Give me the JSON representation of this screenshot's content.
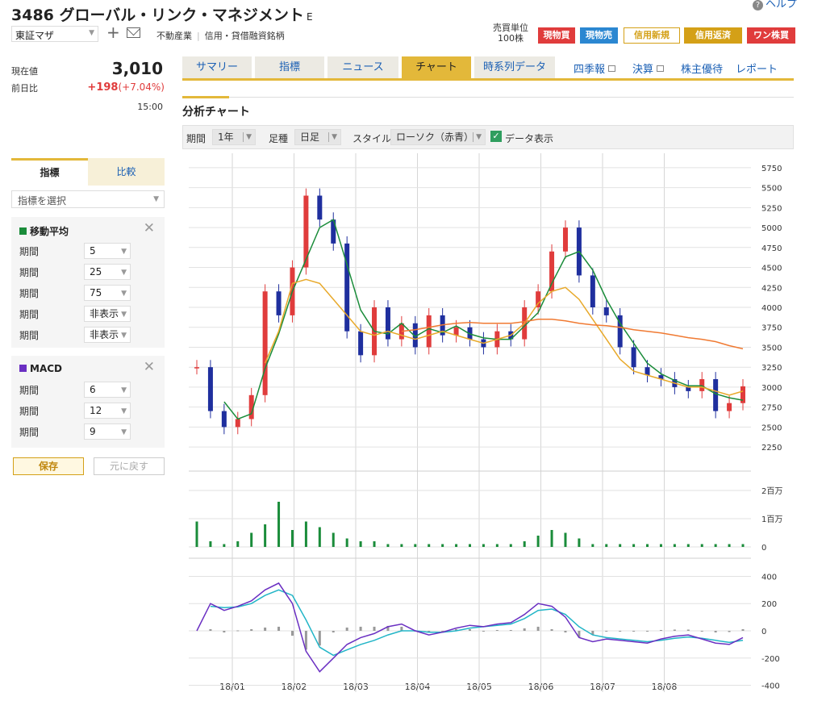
{
  "header": {
    "title": "3486 グローバル・リンク・マネジメント",
    "title_suffix": "E",
    "help": "ヘルプ",
    "market": "東証マザ",
    "sector": "不動産業",
    "margin": "信用・貸借融資銘柄",
    "unit_label_1": "売買単位",
    "unit_label_2": "100株",
    "badges": [
      "現物買",
      "現物売",
      "信用新規",
      "信用返済",
      "ワン株買"
    ]
  },
  "quote": {
    "price_label": "現在値",
    "price": "3,010",
    "change_label": "前日比",
    "change": "+198",
    "change_pct": "(+7.04%)",
    "time": "15:00"
  },
  "tabs": [
    "サマリー",
    "指標",
    "ニュース",
    "チャート",
    "時系列データ"
  ],
  "links": [
    "四季報",
    "決算",
    "株主優待",
    "レポート"
  ],
  "section_title": "分析チャート",
  "toolbar": {
    "period_label": "期間",
    "period_value": "1年",
    "bar_label": "足種",
    "bar_value": "日足",
    "style_label": "スタイル",
    "style_value": "ローソク（赤青）",
    "data_display": "データ表示"
  },
  "side": {
    "tab_indicator": "指標",
    "tab_compare": "比較",
    "select_placeholder": "指標を選択",
    "ma": {
      "title": "移動平均",
      "color": "#1a8c3a",
      "rows": [
        {
          "label": "期間",
          "value": "5"
        },
        {
          "label": "期間",
          "value": "25"
        },
        {
          "label": "期間",
          "value": "75"
        },
        {
          "label": "期間",
          "value": "非表示"
        },
        {
          "label": "期間",
          "value": "非表示"
        }
      ]
    },
    "macd": {
      "title": "MACD",
      "color": "#6a2fc2",
      "rows": [
        {
          "label": "期間",
          "value": "6"
        },
        {
          "label": "期間",
          "value": "12"
        },
        {
          "label": "期間",
          "value": "9"
        }
      ]
    },
    "save": "保存",
    "reset": "元に戻す"
  },
  "chart_data": {
    "type": "line",
    "x_ticks": [
      "18/01",
      "18/02",
      "18/03",
      "18/04",
      "18/05",
      "18/06",
      "18/07",
      "18/08"
    ],
    "price_axis": [
      5750,
      5500,
      5250,
      5000,
      4750,
      4500,
      4250,
      4000,
      3750,
      3500,
      3250,
      3000,
      2750,
      2500,
      2250
    ],
    "volume_axis": [
      "2百万",
      "1百万",
      "0"
    ],
    "macd_axis": [
      400,
      200,
      0,
      -200,
      -400
    ],
    "price": [
      3250,
      2700,
      2500,
      2600,
      2900,
      4200,
      3900,
      4500,
      5400,
      5100,
      4800,
      3700,
      3400,
      4000,
      3600,
      3800,
      3500,
      3900,
      3650,
      3750,
      3600,
      3500,
      3700,
      3600,
      4000,
      4200,
      4700,
      5000,
      4400,
      4000,
      3900,
      3500,
      3250,
      3150,
      3100,
      3000,
      2950,
      3100,
      2700,
      2800,
      3010
    ],
    "ma25": [
      null,
      null,
      null,
      null,
      null,
      3300,
      3700,
      4300,
      4350,
      4300,
      4100,
      3900,
      3700,
      3650,
      3700,
      3650,
      3600,
      3650,
      3700,
      3650,
      3600,
      3550,
      3600,
      3650,
      3800,
      4050,
      4200,
      4250,
      4100,
      3850,
      3600,
      3350,
      3200,
      3150,
      3100,
      3050,
      3000,
      3000,
      2950,
      2900,
      2950
    ],
    "ma75": [
      null,
      null,
      null,
      null,
      null,
      null,
      null,
      null,
      null,
      null,
      null,
      null,
      null,
      null,
      null,
      3700,
      3720,
      3750,
      3780,
      3800,
      3810,
      3800,
      3800,
      3800,
      3820,
      3850,
      3850,
      3830,
      3800,
      3780,
      3770,
      3750,
      3720,
      3700,
      3680,
      3650,
      3620,
      3600,
      3570,
      3520,
      3480
    ],
    "volume": [
      0.9,
      0.2,
      0.1,
      0.2,
      0.5,
      0.8,
      1.6,
      0.6,
      0.9,
      0.7,
      0.5,
      0.3,
      0.2,
      0.2,
      0.1,
      0.1,
      0.1,
      0.1,
      0.1,
      0.1,
      0.1,
      0.1,
      0.1,
      0.1,
      0.2,
      0.4,
      0.6,
      0.5,
      0.3,
      0.1,
      0.1,
      0.1,
      0.1,
      0.1,
      0.1,
      0.1,
      0.1,
      0.1,
      0.1,
      0.1,
      0.1
    ],
    "macd": [
      0,
      200,
      150,
      180,
      220,
      300,
      350,
      200,
      -150,
      -300,
      -200,
      -100,
      -50,
      -20,
      30,
      50,
      0,
      -30,
      -10,
      20,
      40,
      30,
      50,
      60,
      120,
      200,
      180,
      100,
      -50,
      -80,
      -60,
      -70,
      -80,
      -90,
      -60,
      -40,
      -30,
      -60,
      -90,
      -100,
      -50
    ],
    "signal": [
      null,
      180,
      170,
      175,
      200,
      260,
      300,
      260,
      80,
      -120,
      -180,
      -140,
      -100,
      -70,
      -30,
      0,
      0,
      -10,
      -10,
      0,
      20,
      30,
      40,
      50,
      90,
      150,
      160,
      120,
      30,
      -30,
      -50,
      -60,
      -70,
      -80,
      -70,
      -55,
      -45,
      -55,
      -70,
      -85,
      -70
    ],
    "colors": {
      "up": "#e03c3c",
      "down": "#1f2f9e",
      "ma5": "#1a8c3a",
      "ma25": "#e8a92a",
      "ma75": "#f07a32",
      "volume": "#1a8c3a",
      "macd": "#6a2fc2",
      "signal": "#22b5c7",
      "hist": "#999999"
    }
  }
}
